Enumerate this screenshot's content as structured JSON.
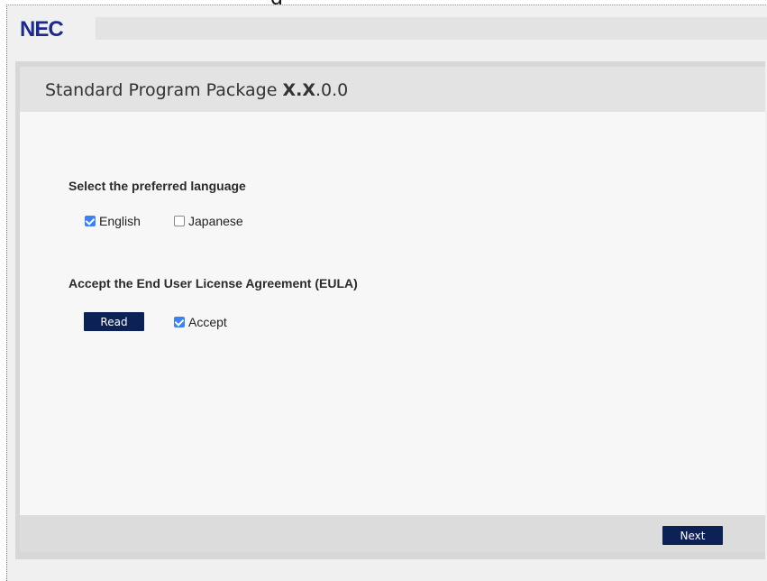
{
  "header": {
    "logo_text": "NEC",
    "top_fragment": "g"
  },
  "panel": {
    "title_prefix": "Standard Program Package ",
    "title_version": "X.X",
    "title_suffix": ".0.0"
  },
  "language": {
    "heading": "Select the preferred language",
    "options": [
      {
        "label": "English",
        "checked": true
      },
      {
        "label": "Japanese",
        "checked": false
      }
    ]
  },
  "eula": {
    "heading": "Accept the End User License Agreement (EULA)",
    "read_label": "Read",
    "accept_label": "Accept",
    "accept_checked": true
  },
  "footer": {
    "next_label": "Next"
  },
  "colors": {
    "brand_navy": "#0c2257",
    "logo_blue": "#1b2a8c",
    "checkbox_blue": "#3b82f6"
  }
}
